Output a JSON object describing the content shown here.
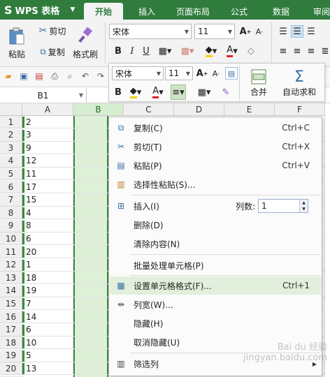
{
  "app": {
    "name": "WPS 表格"
  },
  "tabs": [
    "开始",
    "插入",
    "页面布局",
    "公式",
    "数据",
    "审阅"
  ],
  "ribbon": {
    "paste_label": "粘贴",
    "cut_label": "剪切",
    "copy_label": "复制",
    "format_painter_label": "格式刷",
    "font_name": "宋体",
    "font_size": "11"
  },
  "float_toolbar": {
    "font_name": "宋体",
    "font_size": "11",
    "merge_label": "合并",
    "autosum_label": "自动求和"
  },
  "name_box": "B1",
  "columns": [
    "A",
    "B",
    "C",
    "D",
    "E",
    "F"
  ],
  "rows": [
    "1",
    "2",
    "3",
    "4",
    "5",
    "6",
    "7",
    "8",
    "9",
    "10",
    "11",
    "12",
    "13",
    "14",
    "15",
    "16",
    "17",
    "18",
    "19",
    "20",
    "21"
  ],
  "col_a_values": [
    "2",
    "3",
    "9",
    "12",
    "11",
    "17",
    "15",
    "4",
    "8",
    "6",
    "20",
    "1",
    "18",
    "19",
    "7",
    "14",
    "6",
    "10",
    "5",
    "13",
    ""
  ],
  "context_menu": {
    "copy": {
      "label": "复制(C)",
      "shortcut": "Ctrl+C"
    },
    "cut": {
      "label": "剪切(T)",
      "shortcut": "Ctrl+X"
    },
    "paste": {
      "label": "粘贴(P)",
      "shortcut": "Ctrl+V"
    },
    "paste_special": {
      "label": "选择性粘贴(S)..."
    },
    "insert": {
      "label": "插入(I)",
      "count_label": "列数:",
      "count_value": "1"
    },
    "delete": {
      "label": "删除(D)"
    },
    "clear": {
      "label": "清除内容(N)"
    },
    "batch": {
      "label": "批量处理单元格(P)"
    },
    "format_cells": {
      "label": "设置单元格格式(F)...",
      "shortcut": "Ctrl+1"
    },
    "col_width": {
      "label": "列宽(W)..."
    },
    "hide": {
      "label": "隐藏(H)"
    },
    "unhide": {
      "label": "取消隐藏(U)"
    },
    "filter": {
      "label": "筛选列"
    }
  },
  "colors": {
    "accent": "#2f7c3c",
    "selection": "#dff0d8",
    "highlight": "#e1efdc"
  }
}
